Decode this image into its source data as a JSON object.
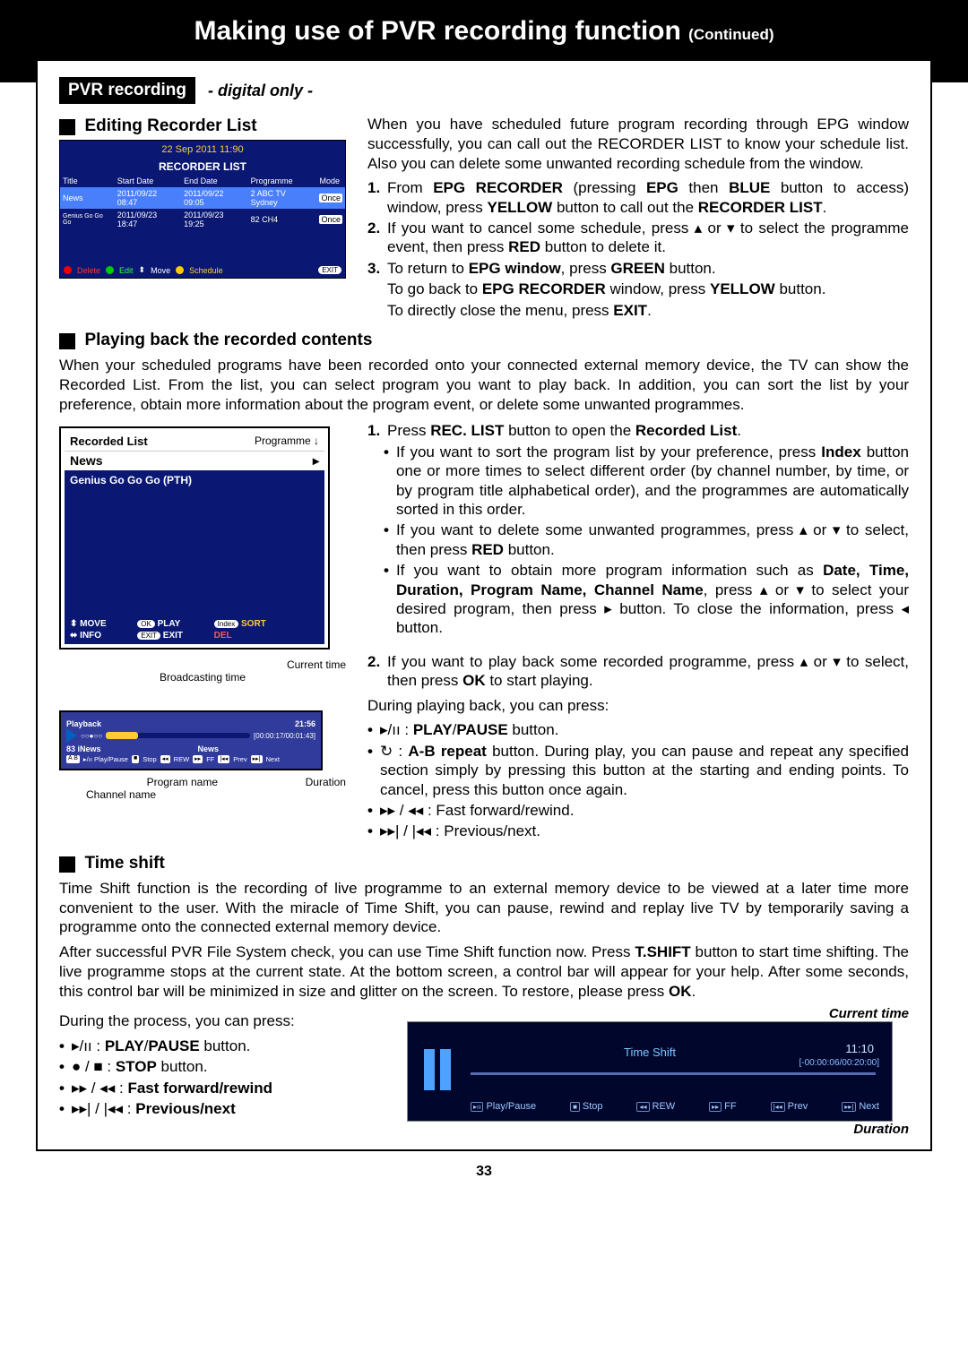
{
  "banner": {
    "title": "Making use of PVR recording function ",
    "cont": "(Continued)"
  },
  "pvr": {
    "label": "PVR recording",
    "digital": "- digital only -"
  },
  "editing": {
    "head": "Editing Recorder List",
    "intro": "When you have scheduled future program recording through EPG window successfully, you can call out the RECORDER LIST to know your schedule list. Also you can delete some unwanted recording schedule from the window.",
    "n1a": "From ",
    "n1b": "EPG RECORDER",
    "n1c": " (pressing ",
    "n1d": "EPG",
    "n1e": " then ",
    "n1f": "BLUE",
    "n1g": " button to access) window, press ",
    "n1h": "YELLOW",
    "n1i": " button to call out the ",
    "n1j": "RECORDER LIST",
    "n1k": ".",
    "n2a": "If you want to cancel some schedule, press ▴ or ▾ to select the programme event, then press ",
    "n2b": "RED",
    "n2c": " button to delete it.",
    "n3a": "To return to ",
    "n3b": "EPG window",
    "n3c": ", press ",
    "n3d": "GREEN",
    "n3e": " button.",
    "l4a": "To go back to ",
    "l4b": "EPG RECORDER",
    "l4c": " window, press ",
    "l4d": "YELLOW",
    "l4e": " button.",
    "l5a": "To directly close the menu, press ",
    "l5b": "EXIT",
    "l5c": "."
  },
  "recorder_shot": {
    "date": "22 Sep 2011  11:90",
    "title": "RECORDER LIST",
    "cols": [
      "Title",
      "Start Date",
      "End Date",
      "Programme",
      "Mode"
    ],
    "rows": [
      [
        "News",
        "2011/09/22 08:47",
        "2011/09/22 09:05",
        "2 ABC TV Sydney",
        "Once"
      ],
      [
        "Genius Go Go Go",
        "2011/09/23 18:47",
        "2011/09/23 19:25",
        "82   CH4",
        "Once"
      ]
    ],
    "footer": {
      "delete": "Delete",
      "edit": "Edit",
      "move": "Move",
      "schedule": "Schedule",
      "exit": "EXIT"
    }
  },
  "playback": {
    "head": "Playing back the recorded contents",
    "intro": "When your scheduled programs have been recorded onto your connected external memory device, the TV can show the Recorded List. From the list, you can select program you want to play back. In addition, you can sort the list by your preference, obtain more information about the program event, or delete some unwanted programmes.",
    "step1a": "Press ",
    "step1b": "REC. LIST",
    "step1c": " button to open the ",
    "step1d": "Recorded List",
    "step1e": ".",
    "b1a": "If you want to sort the program list by your preference, press ",
    "b1b": "Index",
    "b1c": " button one or more times to select different order (by channel number, by time, or by program title alphabetical order), and the programmes are automatically sorted in this order.",
    "b2a": "If you want to delete some unwanted programmes, press ▴ or ▾ to select, then press ",
    "b2b": "RED",
    "b2c": " button.",
    "b3a": "If you want to obtain more program information such as ",
    "b3b": "Date, Time, Duration, Program Name, Channel Name",
    "b3c": ", press ▴ or ▾ to select your desired program, then press  ▸  button. To close the information, press ◂ button.",
    "step2a": "If you want to play back some recorded programme, press ▴ or ▾ to select, then press ",
    "step2b": "OK",
    "step2c": " to start playing.",
    "during": "During playing back, you can press:",
    "c1a": "▸/",
    "c1b": "PLAY",
    "c1c": "/",
    "c1d": "PAUSE",
    "c1e": " button.",
    "c2a": "A-B repeat",
    "c2b": " button. During play, you can pause and repeat any specified section simply by pressing this button at the starting and ending points. To cancel, press this button once again.",
    "c3": "▸▸ / ◂◂ : Fast forward/rewind.",
    "c4": "▸▸| / |◂◂ : Previous/next."
  },
  "recorded_shot": {
    "title": "Recorded List",
    "prog": "Programme  ↓",
    "news": "News",
    "arrow": "▸",
    "genius": "Genius Go Go Go (PTH)",
    "move": "MOVE",
    "ok": "OK",
    "play": "PLAY",
    "index": "Index",
    "sort": "SORT",
    "info": "INFO",
    "exit": "EXIT",
    "del": "DEL"
  },
  "pb_bar": {
    "curr": "Current time",
    "broad": "Broadcasting time",
    "prog": "Program name",
    "dur": "Duration",
    "chan": "Channel name",
    "title": "Playback",
    "time": "21:56",
    "counter": "[00:00:17/00:01:43]",
    "ch": "83 iNews",
    "news": "News",
    "btns": [
      "A  B",
      "▸/ıı Play/Pause",
      "■ Stop",
      "◂◂ REW",
      "▸▸ FF",
      "|◂◂ Prev",
      "▸▸| Next"
    ]
  },
  "timeshift": {
    "head": "Time shift",
    "p1": "Time Shift function is the recording of live programme to an external memory device to be viewed at a later time more convenient to the user. With the miracle of Time Shift, you can pause, rewind and replay live TV by temporarily saving a programme onto the connected external memory device.",
    "p2a": "After successful PVR File System check, you can use Time Shift function now. Press ",
    "p2b": "T.SHIFT",
    "p2c": " button to start time shifting. The live programme stops at the current state. At the bottom screen, a control bar will appear for your help. After some seconds, this control bar will be minimized in size and glitter on the screen. To restore, please press ",
    "p2d": "OK",
    "p2e": ".",
    "during": "During the process, you can press:",
    "l1a": "▸/ıı : ",
    "l1b": "PLAY",
    "l1c": "/",
    "l1d": "PAUSE",
    "l1e": " button.",
    "l2a": "● / ■ : ",
    "l2b": "STOP",
    "l2c": " button.",
    "l3a": "▸▸ / ◂◂ : ",
    "l3b": "Fast forward/rewind",
    "l4a": "▸▸| / |◂◂ : ",
    "l4b": "Previous/next",
    "curr": "Current time",
    "dur": "Duration"
  },
  "ts_img": {
    "title": "Time Shift",
    "time": "11:10",
    "dur": "[-00:00:06/00:20:00]",
    "btns": [
      "Play/Pause",
      "Stop",
      "REW",
      "FF",
      "Prev",
      "Next"
    ]
  },
  "page": "33"
}
